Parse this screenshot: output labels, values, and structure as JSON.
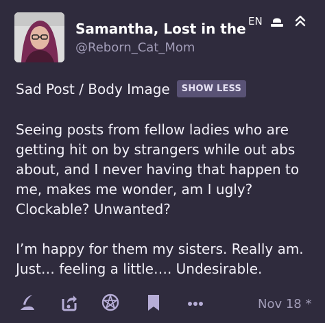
{
  "post": {
    "display_name": "Samantha, Lost in the Inf",
    "handle": "@Reborn_Cat_Mom",
    "language": "EN",
    "content_warning": "Sad Post / Body Image",
    "show_less_label": "SHOW LESS",
    "paragraphs": [
      "Seeing posts from fellow ladies who are getting hit on by strangers while out abs about, and I never having that happen to me, makes me wonder, am I ugly? Clockable? Unwanted?",
      "I’m happy for them my sisters. Really am. Just… feeling a little…. Undesirable."
    ],
    "date": "Nov 18 *"
  },
  "icons": {
    "visibility": "lock-icon",
    "collapse": "chevron-double-up-icon",
    "reply": "reply-quill-icon",
    "boost": "boost-icon",
    "react": "pentagram-icon",
    "bookmark": "bookmark-icon",
    "more": "more-dots-icon"
  },
  "colors": {
    "background": "#2f2b3d",
    "text": "#f2f0f8",
    "muted": "#a29db8",
    "icon": "#b6add6",
    "button": "#595275"
  }
}
